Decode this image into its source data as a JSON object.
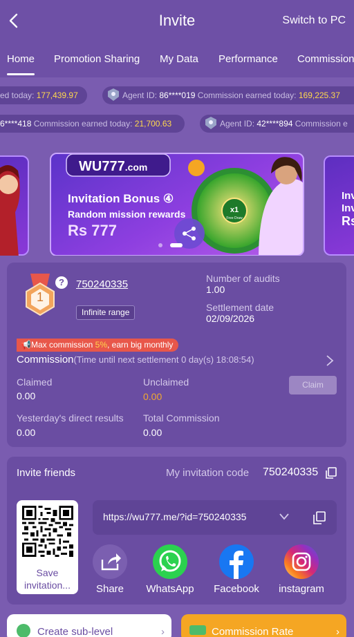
{
  "header": {
    "title": "Invite",
    "switch_label": "Switch to PC"
  },
  "tabs": [
    {
      "label": "Home",
      "active": true
    },
    {
      "label": "Promotion Sharing"
    },
    {
      "label": "My Data"
    },
    {
      "label": "Performance"
    },
    {
      "label": "Commission"
    }
  ],
  "ticker": {
    "row1": [
      {
        "text": "ed today: ",
        "amount": "177,439.97"
      },
      {
        "agent_prefix": "Agent ID: ",
        "agent": "86****019",
        "text": " Commission earned today: ",
        "amount": "169,225.37"
      }
    ],
    "row2": [
      {
        "agent": "6****418",
        "text": " Commission earned today: ",
        "amount": "21,700.63"
      },
      {
        "agent_prefix": "Agent ID: ",
        "agent": "42****894",
        "text": " Commission e"
      }
    ]
  },
  "banner": {
    "brand": "WU777.com",
    "headline": "Invitation Bonus",
    "headline_num": "4",
    "sub": "Random mission rewards",
    "amount": "Rs 777",
    "wheel_center": "x1",
    "wheel_sub": "Free Draw",
    "side_right": [
      "Inv",
      "Inv",
      "Rs"
    ]
  },
  "stats": {
    "level": "1",
    "user_id": "750240335",
    "range_badge": "Infinite range",
    "audits_label": "Number of audits",
    "audits_value": "1.00",
    "settlement_label": "Settlement date",
    "settlement_value": "02/09/2026",
    "promo_prefix": "Max commission ",
    "promo_highlight": "5%",
    "promo_suffix": ", earn big monthly",
    "commission_label": "Commission",
    "commission_sub": "(Time until next settlement  0 day(s) 18:08:54)",
    "claimed_label": "Claimed",
    "claimed_value": "0.00",
    "unclaimed_label": "Unclaimed",
    "unclaimed_value": "0.00",
    "claim_button": "Claim",
    "yesterday_label": "Yesterday's direct results",
    "yesterday_value": "0.00",
    "total_label": "Total Commission",
    "total_value": "0.00"
  },
  "invite": {
    "title": "Invite friends",
    "code_label": "My invitation code",
    "code_value": "750240335",
    "url": "https://wu777.me/?id=750240335",
    "save_label": "Save invitation...",
    "share_items": [
      {
        "label": "Share",
        "icon": "share-icon",
        "color": "#7b5fb0"
      },
      {
        "label": "WhatsApp",
        "icon": "whatsapp-icon",
        "color": "#2bd24f"
      },
      {
        "label": "Facebook",
        "icon": "facebook-icon",
        "color": "#1877f2"
      },
      {
        "label": "instagram",
        "icon": "instagram-icon",
        "color": "#d62976"
      }
    ]
  },
  "bottom": {
    "create_label": "Create sub-level",
    "rate_label": "Commission Rate"
  },
  "colors": {
    "background": "#7a5cb0",
    "header": "#6e50a6",
    "card": "#6a4da2",
    "amount_yellow": "#ffd84d",
    "unclaimed_orange": "#f0a830",
    "promo_red": "#e8574a",
    "rate_button": "#f5a623"
  }
}
